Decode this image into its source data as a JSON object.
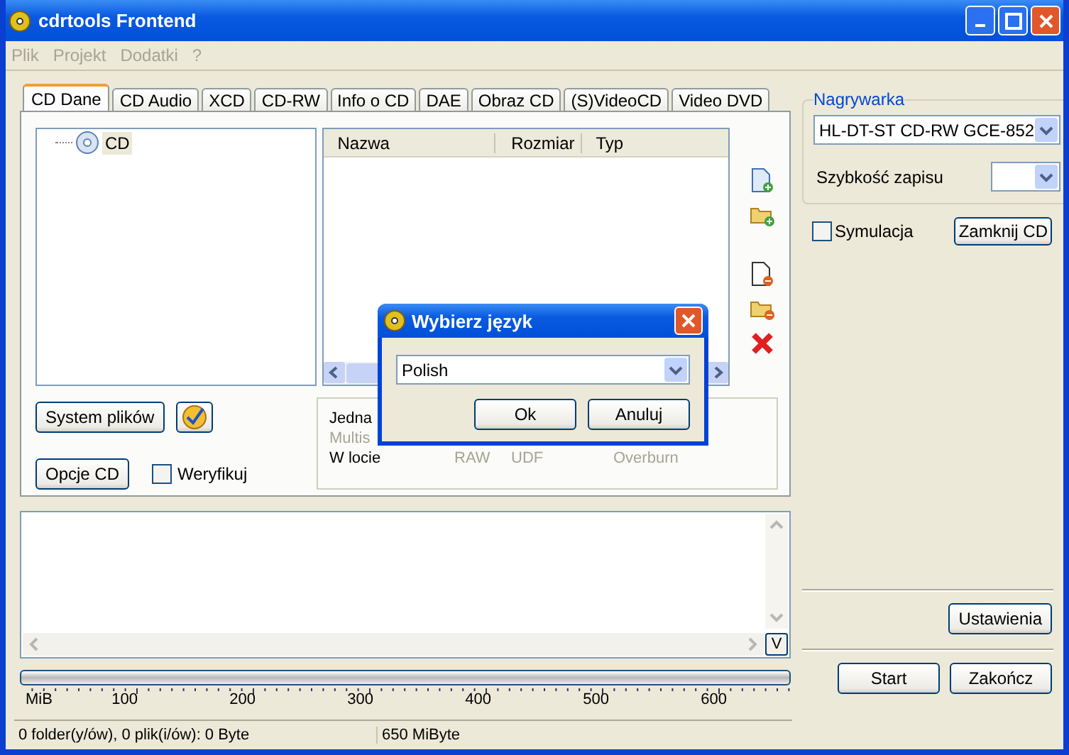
{
  "window": {
    "title": "cdrtools Frontend"
  },
  "menu": [
    {
      "label": "Plik",
      "disabled": true
    },
    {
      "label": "Projekt",
      "disabled": true
    },
    {
      "label": "Dodatki",
      "disabled": true
    },
    {
      "label": "?",
      "disabled": true
    }
  ],
  "tabs": [
    {
      "label": "CD Dane",
      "selected": true
    },
    {
      "label": "CD Audio",
      "selected": false
    },
    {
      "label": "XCD",
      "selected": false
    },
    {
      "label": "CD-RW",
      "selected": false
    },
    {
      "label": "Info o CD",
      "selected": false
    },
    {
      "label": "DAE",
      "selected": false
    },
    {
      "label": "Obraz CD",
      "selected": false
    },
    {
      "label": "(S)VideoCD",
      "selected": false
    },
    {
      "label": "Video DVD",
      "selected": false
    }
  ],
  "tree": {
    "items": [
      {
        "label": "CD",
        "selected": true
      }
    ]
  },
  "file_list": {
    "columns": [
      "Nazwa",
      "Rozmiar",
      "Typ"
    ]
  },
  "filesystem_button": "System plików",
  "cd_options_button": "Opcje CD",
  "verify": {
    "label": "Weryfikuj",
    "checked": false
  },
  "write_mode": {
    "rows": [
      [
        {
          "label": "Jedna",
          "disabled": false
        }
      ],
      [
        {
          "label": "Multis",
          "disabled": true
        }
      ],
      [
        {
          "label": "W locie",
          "disabled": false
        },
        {
          "label": "RAW",
          "disabled": true
        },
        {
          "label": "UDF",
          "disabled": true
        },
        {
          "label": "Overburn",
          "disabled": true
        }
      ]
    ]
  },
  "recorder": {
    "legend": "Nagrywarka",
    "drive": "HL-DT-ST CD-RW GCE-852",
    "speed_label": "Szybkość zapisu"
  },
  "simulate": {
    "label": "Symulacja",
    "checked": false
  },
  "close_cd_button": "Zamknij CD",
  "settings_button": "Ustawienia",
  "start_button": "Start",
  "exit_button": "Zakończ",
  "log": {
    "toggle": "V"
  },
  "capacity": {
    "level": 0,
    "scale": [
      "MiB",
      "100",
      "200",
      "300",
      "400",
      "500",
      "600"
    ]
  },
  "status_bar": [
    "0 folder(y/ów), 0 plik(i/ów): 0 Byte",
    "650 MiByte"
  ],
  "dialog": {
    "title": "Wybierz język",
    "language": "Polish",
    "buttons": [
      "Ok",
      "Anuluj"
    ]
  }
}
